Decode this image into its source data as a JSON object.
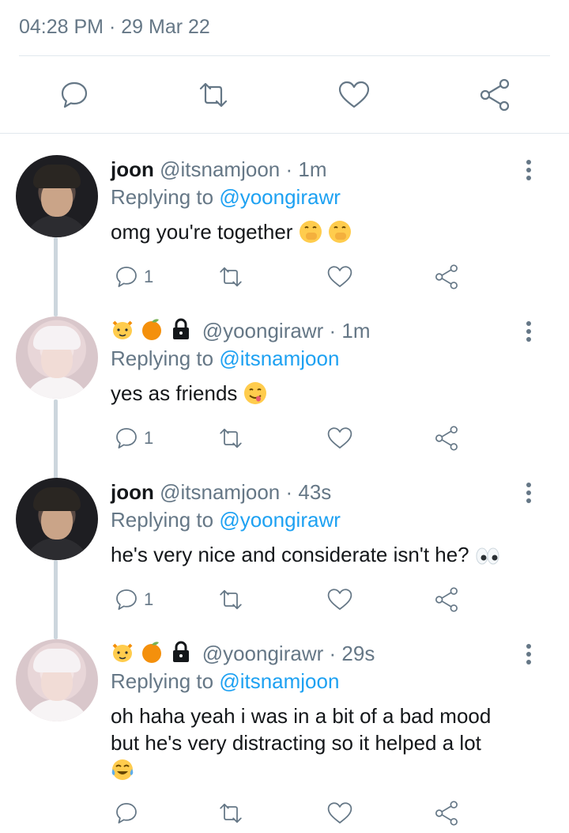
{
  "header": {
    "time": "04:28 PM",
    "separator": "·",
    "date": "29 Mar 22"
  },
  "main_actions": [
    "reply-icon",
    "retweet-icon",
    "like-icon",
    "share-icon"
  ],
  "tweets": [
    {
      "name": "joon",
      "handle": "@itsnamjoon",
      "separator": "·",
      "time": "1m",
      "replying_label": "Replying to",
      "replying_to": "@yoongirawr",
      "text": "omg you're together",
      "text_emojis": [
        "hand-over-mouth-emoji",
        "hand-over-mouth-emoji"
      ],
      "reply_count": "1"
    },
    {
      "name_emojis": [
        "cat-emoji",
        "tangerine-emoji",
        "lock-emoji"
      ],
      "handle": "@yoongirawr",
      "separator": "·",
      "time": "1m",
      "replying_label": "Replying to",
      "replying_to": "@itsnamjoon",
      "text": "yes as friends",
      "text_emojis": [
        "yum-face-emoji"
      ],
      "reply_count": "1"
    },
    {
      "name": "joon",
      "handle": "@itsnamjoon",
      "separator": "·",
      "time": "43s",
      "replying_label": "Replying to",
      "replying_to": "@yoongirawr",
      "text": "he's very nice and considerate isn't he?",
      "text_emojis": [
        "eyes-emoji"
      ],
      "reply_count": "1"
    },
    {
      "name_emojis": [
        "cat-emoji",
        "tangerine-emoji",
        "lock-emoji"
      ],
      "handle": "@yoongirawr",
      "separator": "·",
      "time": "29s",
      "replying_label": "Replying to",
      "replying_to": "@itsnamjoon",
      "text_line1": "oh haha yeah i was in a bit of a bad mood",
      "text_line2": "but he's very distracting so it helped a lot",
      "text_emojis": [
        "tears-of-joy-emoji"
      ],
      "reply_count": ""
    }
  ],
  "colors": {
    "accent": "#1da1f2",
    "muted": "#657786",
    "divider": "#e1e8ed",
    "thread": "#ccd6dd"
  }
}
